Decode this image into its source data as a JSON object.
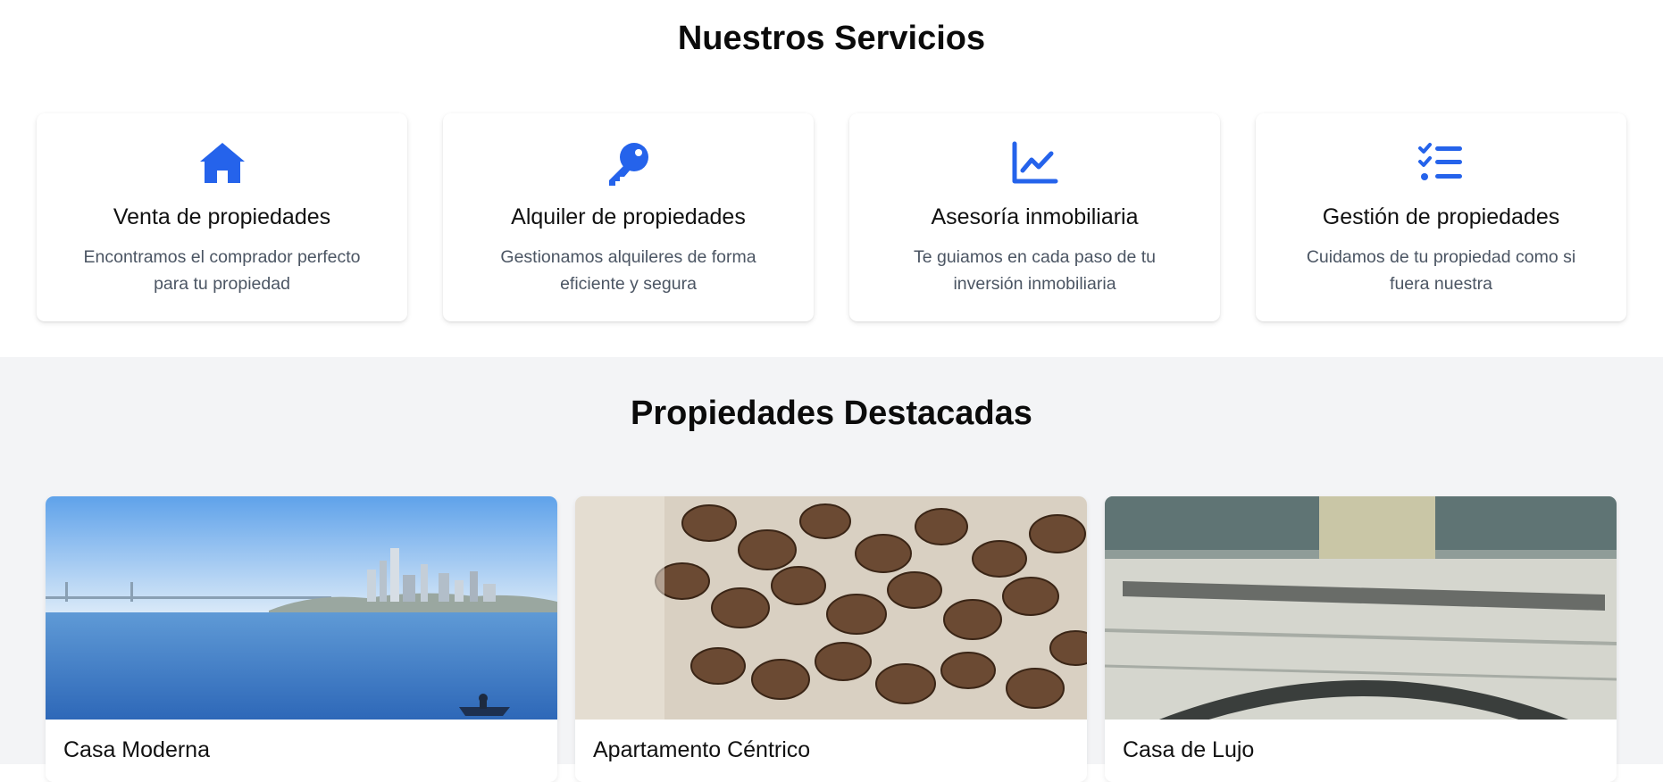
{
  "services": {
    "title": "Nuestros Servicios",
    "items": [
      {
        "icon": "house-icon",
        "title": "Venta de propiedades",
        "description": "Encontramos el comprador perfecto para tu propiedad"
      },
      {
        "icon": "key-icon",
        "title": "Alquiler de propiedades",
        "description": "Gestionamos alquileres de forma eficiente y segura"
      },
      {
        "icon": "chart-line-icon",
        "title": "Asesoría inmobiliaria",
        "description": "Te guiamos en cada paso de tu inversión inmobiliaria"
      },
      {
        "icon": "checklist-icon",
        "title": "Gestión de propiedades",
        "description": "Cuidamos de tu propiedad como si fuera nuestra"
      }
    ]
  },
  "featured": {
    "title": "Propiedades Destacadas",
    "properties": [
      {
        "title": "Casa Moderna",
        "image": "city-skyline-waterfront-photo"
      },
      {
        "title": "Apartamento Céntrico",
        "image": "coffee-beans-photo"
      },
      {
        "title": "Casa de Lujo",
        "image": "desk-papers-photo"
      }
    ]
  },
  "colors": {
    "accent": "#2563eb",
    "section_alt_bg": "#f3f4f6",
    "muted_text": "#4b5563"
  }
}
